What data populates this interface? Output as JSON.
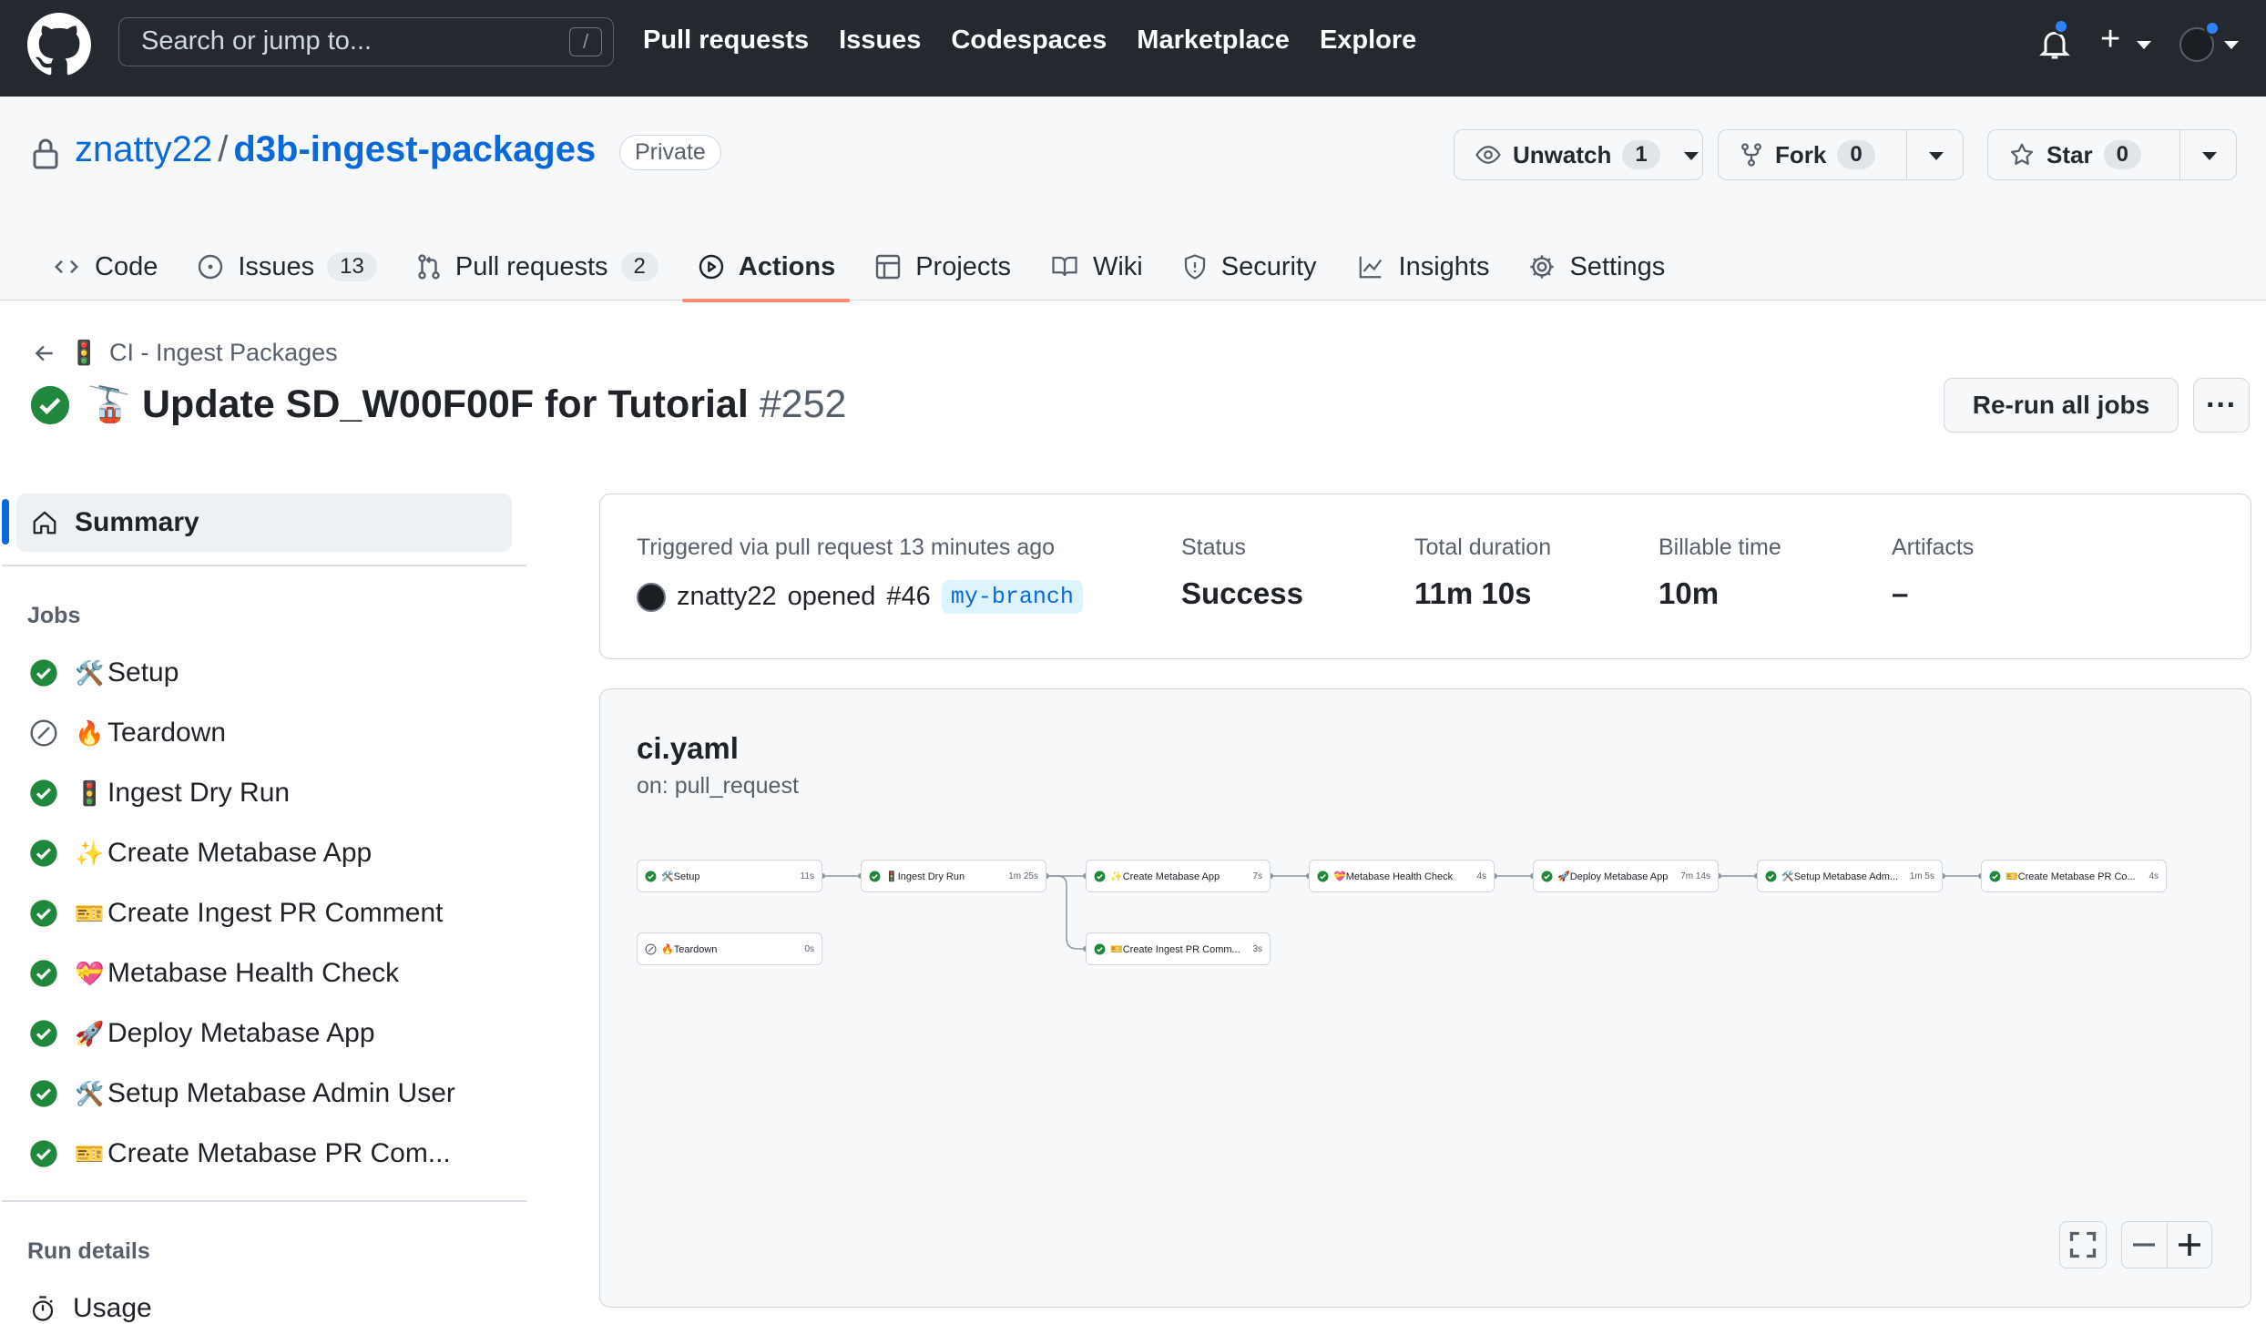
{
  "header": {
    "search_placeholder": "Search or jump to...",
    "search_shortcut": "/",
    "nav": [
      "Pull requests",
      "Issues",
      "Codespaces",
      "Marketplace",
      "Explore"
    ],
    "plus": "+"
  },
  "repo": {
    "owner": "znatty22",
    "separator": "/",
    "name": "d3b-ingest-packages",
    "visibility": "Private",
    "unwatch": {
      "label": "Unwatch",
      "count": "1"
    },
    "fork": {
      "label": "Fork",
      "count": "0"
    },
    "star": {
      "label": "Star",
      "count": "0"
    },
    "tabs": [
      {
        "label": "Code",
        "icon": "code-icon"
      },
      {
        "label": "Issues",
        "count": "13",
        "icon": "issue-icon"
      },
      {
        "label": "Pull requests",
        "count": "2",
        "icon": "pull-request-icon"
      },
      {
        "label": "Actions",
        "icon": "play-icon",
        "active": true
      },
      {
        "label": "Projects",
        "icon": "table-icon"
      },
      {
        "label": "Wiki",
        "icon": "book-icon"
      },
      {
        "label": "Security",
        "icon": "shield-icon"
      },
      {
        "label": "Insights",
        "icon": "graph-icon"
      },
      {
        "label": "Settings",
        "icon": "gear-icon"
      }
    ]
  },
  "run": {
    "workflow_emoji": "🚦",
    "workflow": "CI - Ingest Packages",
    "title_emoji": "🚡",
    "title": "Update SD_W00F00F for Tutorial",
    "number": "#252",
    "rerun_label": "Re-run all jobs",
    "more_label": "···"
  },
  "sidebar": {
    "summary_label": "Summary",
    "jobs_heading": "Jobs",
    "jobs": [
      {
        "emoji": "🛠️",
        "name": "Setup",
        "status": "success"
      },
      {
        "emoji": "🔥",
        "name": "Teardown",
        "status": "skipped"
      },
      {
        "emoji": "🚦",
        "name": "Ingest Dry Run",
        "status": "success"
      },
      {
        "emoji": "✨",
        "name": "Create Metabase App",
        "status": "success"
      },
      {
        "emoji": "🎫",
        "name": "Create Ingest PR Comment",
        "status": "success"
      },
      {
        "emoji": "💝",
        "name": "Metabase Health Check",
        "status": "success"
      },
      {
        "emoji": "🚀",
        "name": "Deploy Metabase App",
        "status": "success"
      },
      {
        "emoji": "🛠️",
        "name": "Setup Metabase Admin User",
        "status": "success"
      },
      {
        "emoji": "🎫",
        "name": "Create Metabase PR Com...",
        "status": "success"
      }
    ],
    "run_details_heading": "Run details",
    "usage_label": "Usage"
  },
  "summary": {
    "trigger_text": "Triggered via pull request 13 minutes ago",
    "actor": "znatty22",
    "action": "opened",
    "pr": "#46",
    "branch": "my-branch",
    "status_label": "Status",
    "status_value": "Success",
    "duration_label": "Total duration",
    "duration_value": "11m 10s",
    "billable_label": "Billable time",
    "billable_value": "10m",
    "artifacts_label": "Artifacts",
    "artifacts_value": "–"
  },
  "graph": {
    "file": "ci.yaml",
    "trigger": "on: pull_request",
    "nodes": [
      {
        "emoji": "🛠️",
        "name": "Setup",
        "duration": "11s",
        "status": "success"
      },
      {
        "emoji": "🔥",
        "name": "Teardown",
        "duration": "0s",
        "status": "skipped"
      },
      {
        "emoji": "🚦",
        "name": "Ingest Dry Run",
        "duration": "1m 25s",
        "status": "success"
      },
      {
        "emoji": "✨",
        "name": "Create Metabase App",
        "duration": "7s",
        "status": "success"
      },
      {
        "emoji": "🎫",
        "name": "Create Ingest PR Comm...",
        "duration": "3s",
        "status": "success"
      },
      {
        "emoji": "💝",
        "name": "Metabase Health Check",
        "duration": "4s",
        "status": "success"
      },
      {
        "emoji": "🚀",
        "name": "Deploy Metabase App",
        "duration": "7m 14s",
        "status": "success"
      },
      {
        "emoji": "🛠️",
        "name": "Setup Metabase Adm...",
        "duration": "1m 5s",
        "status": "success"
      },
      {
        "emoji": "🎫",
        "name": "Create Metabase PR Co...",
        "duration": "4s",
        "status": "success"
      }
    ]
  },
  "colors": {
    "header_bg": "#24292f",
    "link": "#0969da",
    "success": "#1f883d",
    "muted": "#57606a",
    "active_tab_underline": "#fd8c73",
    "notification_dot": "#2f81f7"
  }
}
